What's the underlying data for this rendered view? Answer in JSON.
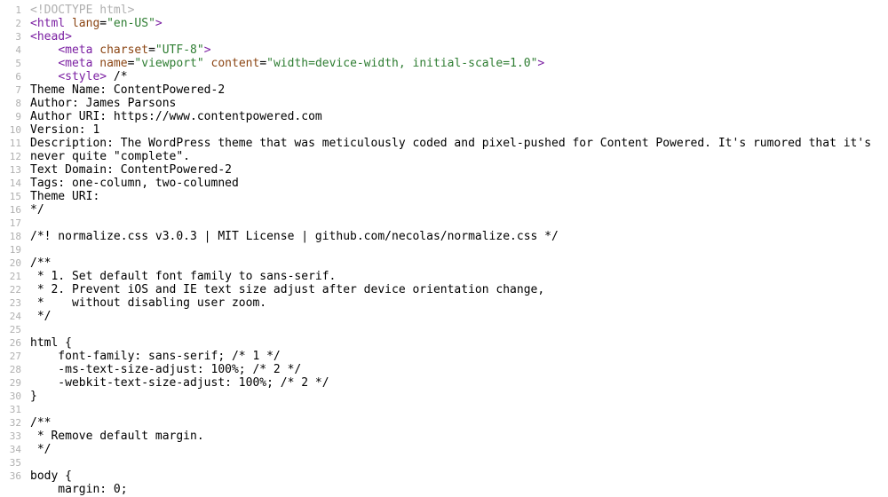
{
  "line_numbers": [
    "1",
    "2",
    "3",
    "4",
    "5",
    "6",
    "7",
    "8",
    "9",
    "10",
    "11",
    "12",
    "13",
    "14",
    "15",
    "16",
    "17",
    "18",
    "19",
    "20",
    "21",
    "22",
    "23",
    "24",
    "25",
    "26",
    "27",
    "28",
    "29",
    "30",
    "31",
    "32",
    "33",
    "34",
    "35",
    "36"
  ],
  "lines": [
    [
      {
        "t": "<!DOCTYPE html>",
        "c": "t-decl"
      }
    ],
    [
      {
        "t": "<",
        "c": "t-punc"
      },
      {
        "t": "html",
        "c": "t-tag"
      },
      {
        "t": " ",
        "c": "t-plain"
      },
      {
        "t": "lang",
        "c": "t-attr"
      },
      {
        "t": "=",
        "c": "t-eq"
      },
      {
        "t": "\"en-US\"",
        "c": "t-str"
      },
      {
        "t": ">",
        "c": "t-punc"
      }
    ],
    [
      {
        "t": "<",
        "c": "t-punc"
      },
      {
        "t": "head",
        "c": "t-tag"
      },
      {
        "t": ">",
        "c": "t-punc"
      }
    ],
    [
      {
        "t": "    ",
        "c": "t-plain"
      },
      {
        "t": "<",
        "c": "t-punc"
      },
      {
        "t": "meta",
        "c": "t-tag"
      },
      {
        "t": " ",
        "c": "t-plain"
      },
      {
        "t": "charset",
        "c": "t-attr"
      },
      {
        "t": "=",
        "c": "t-eq"
      },
      {
        "t": "\"UTF-8\"",
        "c": "t-str"
      },
      {
        "t": ">",
        "c": "t-punc"
      }
    ],
    [
      {
        "t": "    ",
        "c": "t-plain"
      },
      {
        "t": "<",
        "c": "t-punc"
      },
      {
        "t": "meta",
        "c": "t-tag"
      },
      {
        "t": " ",
        "c": "t-plain"
      },
      {
        "t": "name",
        "c": "t-attr"
      },
      {
        "t": "=",
        "c": "t-eq"
      },
      {
        "t": "\"viewport\"",
        "c": "t-str"
      },
      {
        "t": " ",
        "c": "t-plain"
      },
      {
        "t": "content",
        "c": "t-attr"
      },
      {
        "t": "=",
        "c": "t-eq"
      },
      {
        "t": "\"width=device-width, initial-scale=1.0\"",
        "c": "t-str"
      },
      {
        "t": ">",
        "c": "t-punc"
      }
    ],
    [
      {
        "t": "    ",
        "c": "t-plain"
      },
      {
        "t": "<",
        "c": "t-punc"
      },
      {
        "t": "style",
        "c": "t-tag"
      },
      {
        "t": ">",
        "c": "t-punc"
      },
      {
        "t": " /*",
        "c": "t-plain"
      }
    ],
    [
      {
        "t": "Theme Name: ContentPowered-2",
        "c": "t-plain"
      }
    ],
    [
      {
        "t": "Author: James Parsons",
        "c": "t-plain"
      }
    ],
    [
      {
        "t": "Author URI: https://www.contentpowered.com",
        "c": "t-plain"
      }
    ],
    [
      {
        "t": "Version: 1",
        "c": "t-plain"
      }
    ],
    [
      {
        "t": "Description: The WordPress theme that was meticulously coded and pixel-pushed for Content Powered. It's rumored that it's",
        "c": "t-plain"
      }
    ],
    [
      {
        "t": "never quite \"complete\".",
        "c": "t-plain"
      }
    ],
    [
      {
        "t": "Text Domain: ContentPowered-2",
        "c": "t-plain"
      }
    ],
    [
      {
        "t": "Tags: one-column, two-columned",
        "c": "t-plain"
      }
    ],
    [
      {
        "t": "Theme URI:",
        "c": "t-plain"
      }
    ],
    [
      {
        "t": "*/",
        "c": "t-plain"
      }
    ],
    [
      {
        "t": "",
        "c": "t-plain"
      }
    ],
    [
      {
        "t": "/*! normalize.css v3.0.3 | MIT License | github.com/necolas/normalize.css */",
        "c": "t-plain"
      }
    ],
    [
      {
        "t": "",
        "c": "t-plain"
      }
    ],
    [
      {
        "t": "/**",
        "c": "t-plain"
      }
    ],
    [
      {
        "t": " * 1. Set default font family to sans-serif.",
        "c": "t-plain"
      }
    ],
    [
      {
        "t": " * 2. Prevent iOS and IE text size adjust after device orientation change,",
        "c": "t-plain"
      }
    ],
    [
      {
        "t": " *    without disabling user zoom.",
        "c": "t-plain"
      }
    ],
    [
      {
        "t": " */",
        "c": "t-plain"
      }
    ],
    [
      {
        "t": "",
        "c": "t-plain"
      }
    ],
    [
      {
        "t": "html {",
        "c": "t-plain"
      }
    ],
    [
      {
        "t": "    font-family: sans-serif; /* 1 */",
        "c": "t-plain"
      }
    ],
    [
      {
        "t": "    -ms-text-size-adjust: 100%; /* 2 */",
        "c": "t-plain"
      }
    ],
    [
      {
        "t": "    -webkit-text-size-adjust: 100%; /* 2 */",
        "c": "t-plain"
      }
    ],
    [
      {
        "t": "}",
        "c": "t-plain"
      }
    ],
    [
      {
        "t": "",
        "c": "t-plain"
      }
    ],
    [
      {
        "t": "/**",
        "c": "t-plain"
      }
    ],
    [
      {
        "t": " * Remove default margin.",
        "c": "t-plain"
      }
    ],
    [
      {
        "t": " */",
        "c": "t-plain"
      }
    ],
    [
      {
        "t": "",
        "c": "t-plain"
      }
    ],
    [
      {
        "t": "body {",
        "c": "t-plain"
      }
    ],
    [
      {
        "t": "    margin: 0;",
        "c": "t-plain"
      }
    ]
  ]
}
